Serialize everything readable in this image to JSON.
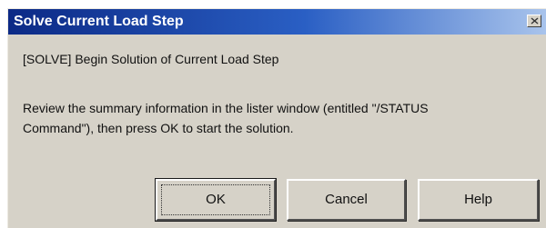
{
  "window": {
    "title": "Solve Current Load Step",
    "close_glyph": "×"
  },
  "message": {
    "line1": "[SOLVE] Begin Solution of Current Load Step",
    "line2": "Review the summary information in the lister window (entitled  \"/STATUS",
    "line3": "Command\"), then press OK to start the solution."
  },
  "buttons": {
    "ok": "OK",
    "cancel": "Cancel",
    "help": "Help"
  },
  "colors": {
    "titlebar_start": "#0c2a86",
    "titlebar_end": "#a9c4ec",
    "dialog_face": "#d6d2c8"
  },
  "icons": {
    "close": "close-icon"
  }
}
